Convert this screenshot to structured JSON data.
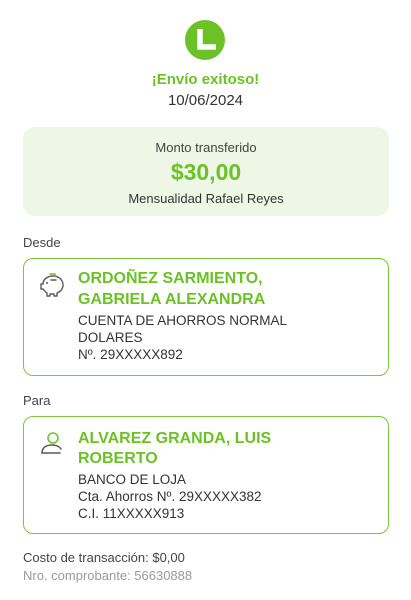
{
  "status": {
    "title": "¡Envío exitoso!",
    "date": "10/06/2024"
  },
  "amount": {
    "label": "Monto transferido",
    "value": "$30,00",
    "description": "Mensualidad Rafael Reyes"
  },
  "from": {
    "section_label": "Desde",
    "icon": "piggy-bank-icon",
    "name_line1": "ORDOÑEZ SARMIENTO,",
    "name_line2": "GABRIELA ALEXANDRA",
    "account_type_line1": "CUENTA DE AHORROS NORMAL",
    "account_type_line2": "DOLARES",
    "account_number": "Nº. 29XXXXX892"
  },
  "to": {
    "section_label": "Para",
    "icon": "user-icon",
    "name_line1": "ALVAREZ GRANDA, LUIS",
    "name_line2": "ROBERTO",
    "bank": "BANCO DE LOJA",
    "account": "Cta. Ahorros Nº. 29XXXXX382",
    "id": "C.I. 11XXXXX913"
  },
  "footer": {
    "cost": "Costo de transacción: $0,00",
    "receipt": "Nro. comprobante: 56630888"
  },
  "colors": {
    "accent": "#6cc126",
    "card_bg": "#eef7e5",
    "border": "#7cc63a"
  }
}
